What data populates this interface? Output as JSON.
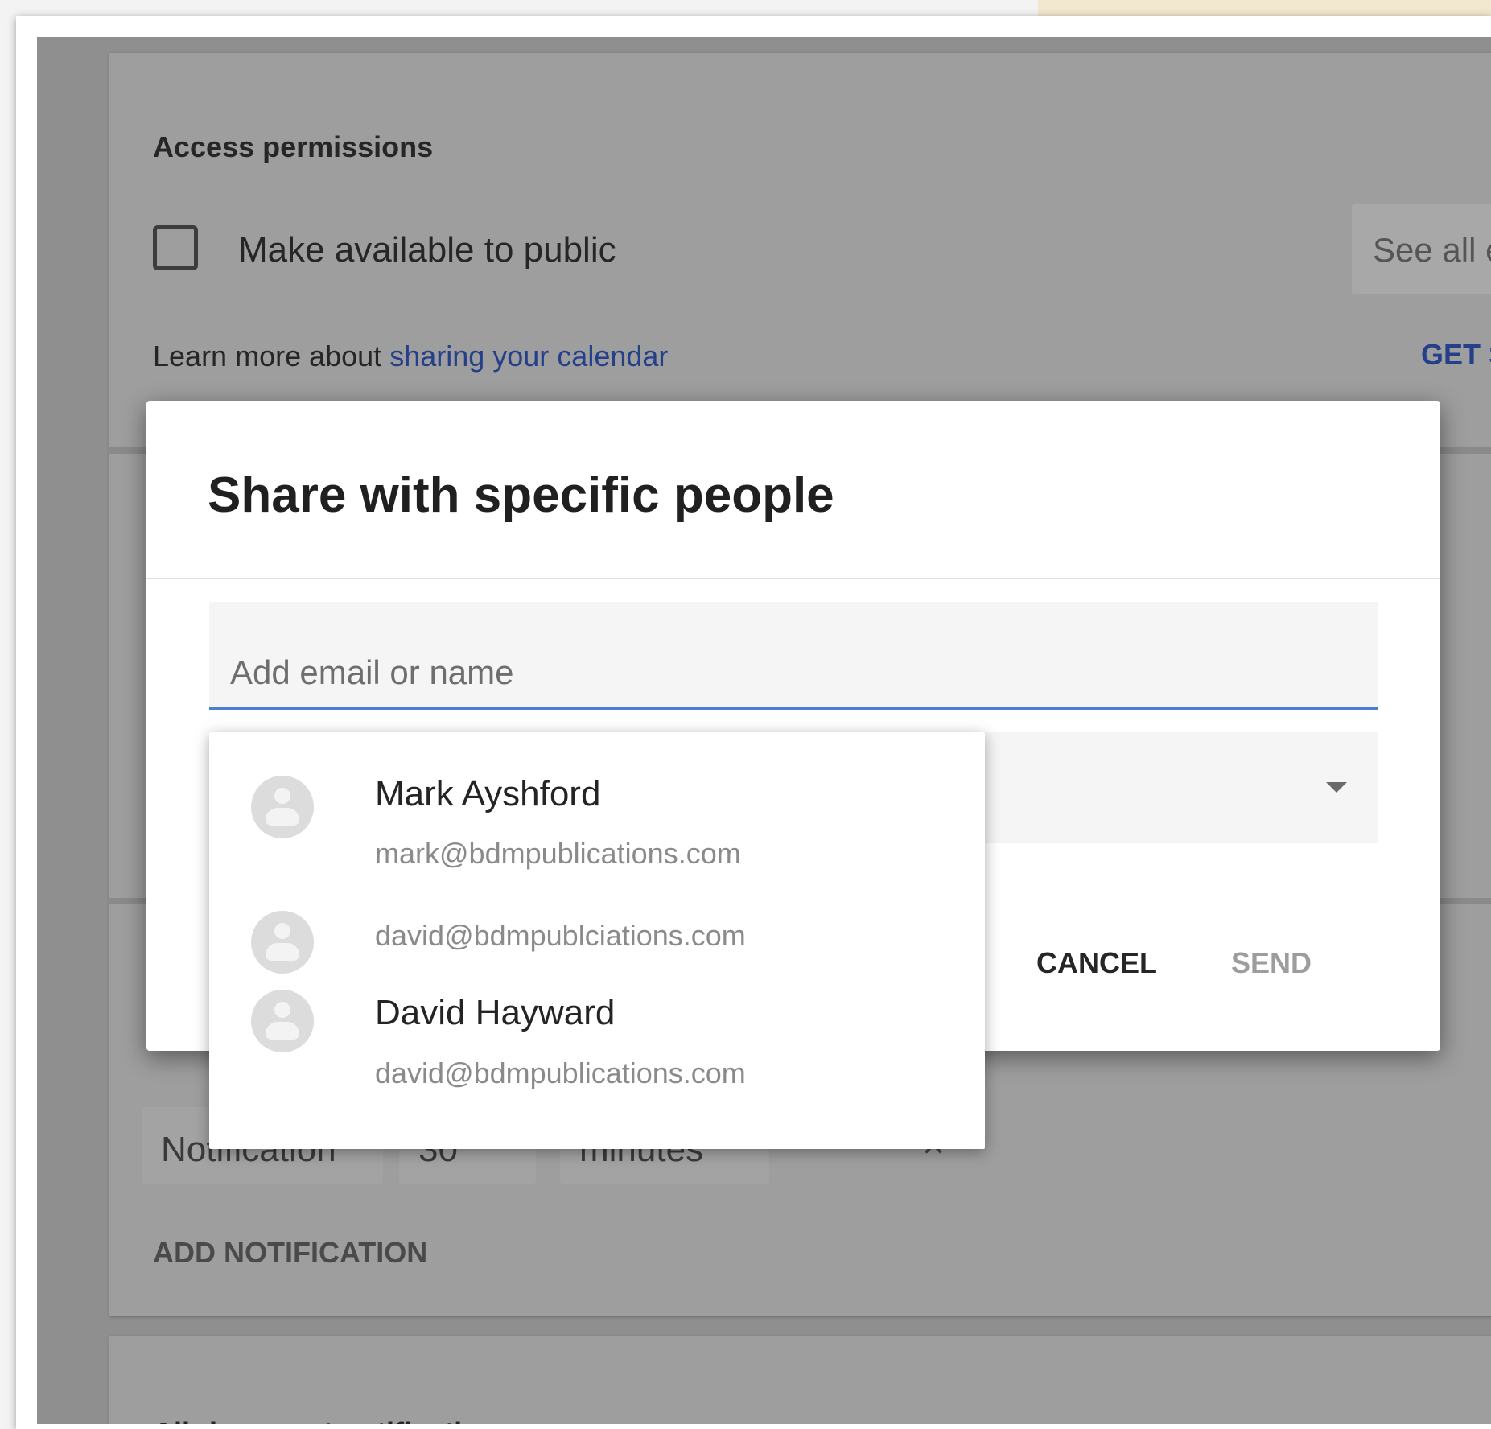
{
  "settings": {
    "section_title": "Access permissions",
    "public_checkbox_label": "Make available to public",
    "see_all_button": "See all e",
    "learn_more_text": "Learn more about ",
    "learn_more_link": "sharing your calendar",
    "get_link": "GET SH"
  },
  "notifications": {
    "type_value": "Notification",
    "amount_value": "30",
    "unit_value": "minutes",
    "remove_icon": "×",
    "add_label": "ADD NOTIFICATION",
    "all_day_title": "All-day event notifications"
  },
  "dialog": {
    "title": "Share with specific people",
    "input_placeholder": "Add email or name",
    "input_value": "",
    "permission_value": "",
    "cancel_label": "CANCEL",
    "send_label": "SEND"
  },
  "suggestions": [
    {
      "name": "Mark Ayshford",
      "email": "mark@bdmpublications.com"
    },
    {
      "name": "",
      "email": "david@bdmpublciations.com"
    },
    {
      "name": "David Hayward",
      "email": "david@bdmpublications.com"
    }
  ],
  "colors": {
    "accent_blue": "#4a7fd1",
    "link_blue": "#253f8a",
    "backdrop": "#8f8f8f",
    "dialog_bg": "#ffffff"
  }
}
